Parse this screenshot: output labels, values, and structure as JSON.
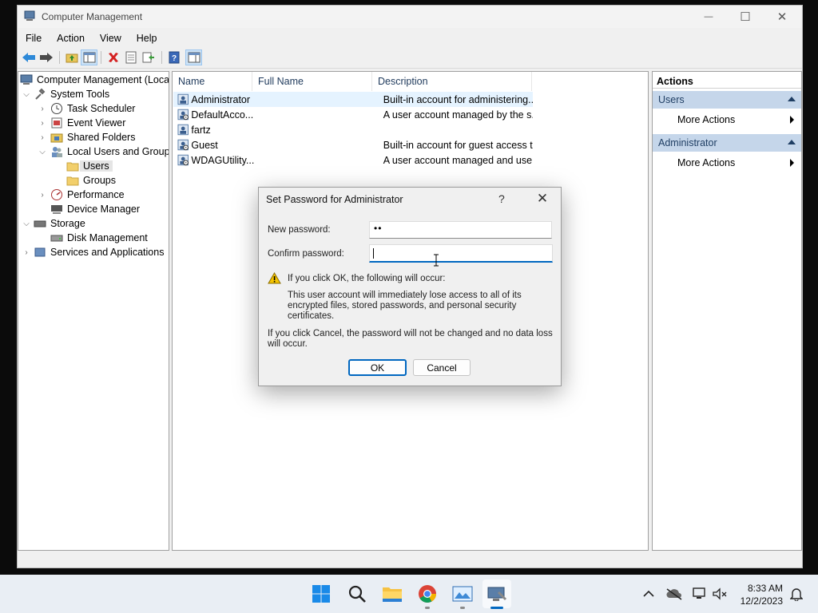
{
  "window": {
    "title": "Computer Management",
    "controls": {
      "minimize": "—",
      "maximize": "☐",
      "close": "✕"
    }
  },
  "menu": [
    "File",
    "Action",
    "View",
    "Help"
  ],
  "tree": [
    {
      "label": "Computer Management (Local",
      "icon": "computer-management-icon"
    },
    {
      "label": "System Tools",
      "icon": "system-tools-icon"
    },
    {
      "label": "Task Scheduler",
      "icon": "clock-icon"
    },
    {
      "label": "Event Viewer",
      "icon": "event-viewer-icon"
    },
    {
      "label": "Shared Folders",
      "icon": "shared-folder-icon"
    },
    {
      "label": "Local Users and Groups",
      "icon": "users-groups-icon"
    },
    {
      "label": "Users",
      "icon": "folder-icon"
    },
    {
      "label": "Groups",
      "icon": "folder-icon"
    },
    {
      "label": "Performance",
      "icon": "performance-icon"
    },
    {
      "label": "Device Manager",
      "icon": "device-manager-icon"
    },
    {
      "label": "Storage",
      "icon": "storage-icon"
    },
    {
      "label": "Disk Management",
      "icon": "disk-icon"
    },
    {
      "label": "Services and Applications",
      "icon": "services-icon"
    }
  ],
  "list": {
    "columns": [
      "Name",
      "Full Name",
      "Description"
    ],
    "rows": [
      {
        "name": "Administrator",
        "full_name": "",
        "description": "Built-in account for administering..."
      },
      {
        "name": "DefaultAcco...",
        "full_name": "",
        "description": "A user account managed by the s..."
      },
      {
        "name": "fartz",
        "full_name": "",
        "description": ""
      },
      {
        "name": "Guest",
        "full_name": "",
        "description": "Built-in account for guest access t..."
      },
      {
        "name": "WDAGUtility...",
        "full_name": "",
        "description": "A user account managed and use..."
      }
    ]
  },
  "actions": {
    "title": "Actions",
    "sections": [
      {
        "header": "Users",
        "item": "More Actions"
      },
      {
        "header": "Administrator",
        "item": "More Actions"
      }
    ]
  },
  "dialog": {
    "title": "Set Password for Administrator",
    "help": "?",
    "close": "✕",
    "new_password_label": "New password:",
    "new_password_value": "••",
    "confirm_password_label": "Confirm password:",
    "confirm_password_value": "",
    "warning_heading": "If you click OK, the following will occur:",
    "warning_body": "This user account will immediately lose access to all of its encrypted files, stored passwords, and personal security certificates.",
    "cancel_note": "If you click Cancel, the password will not be changed and no data loss will occur.",
    "ok_label": "OK",
    "cancel_label": "Cancel"
  },
  "taskbar": {
    "time": "8:33 AM",
    "date": "12/2/2023"
  },
  "colors": {
    "accent": "#0067c0",
    "actions_header": "#c5d6ea",
    "selection": "#e5f3ff"
  }
}
